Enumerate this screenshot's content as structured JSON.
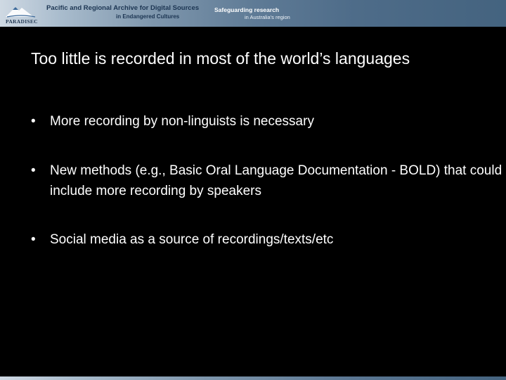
{
  "banner": {
    "logo_text": "PARADISEC",
    "title_line1": "Pacific and Regional Archive for Digital Sources",
    "title_line2": "in Endangered Cultures",
    "tagline_line1": "Safeguarding research",
    "tagline_line2": "in Australia's region"
  },
  "slide": {
    "title": "Too little is recorded in most of the world’s languages",
    "bullets": [
      "More recording by non-linguists is necessary",
      "New methods (e.g., Basic Oral Language Documentation - BOLD) that could include more recording by speakers",
      "Social media as a source of recordings/texts/etc"
    ],
    "bullet_symbol": "•"
  },
  "colors": {
    "background": "#000000",
    "text": "#ffffff",
    "banner_dark": "#44637f",
    "banner_light": "#cfd9e3"
  }
}
